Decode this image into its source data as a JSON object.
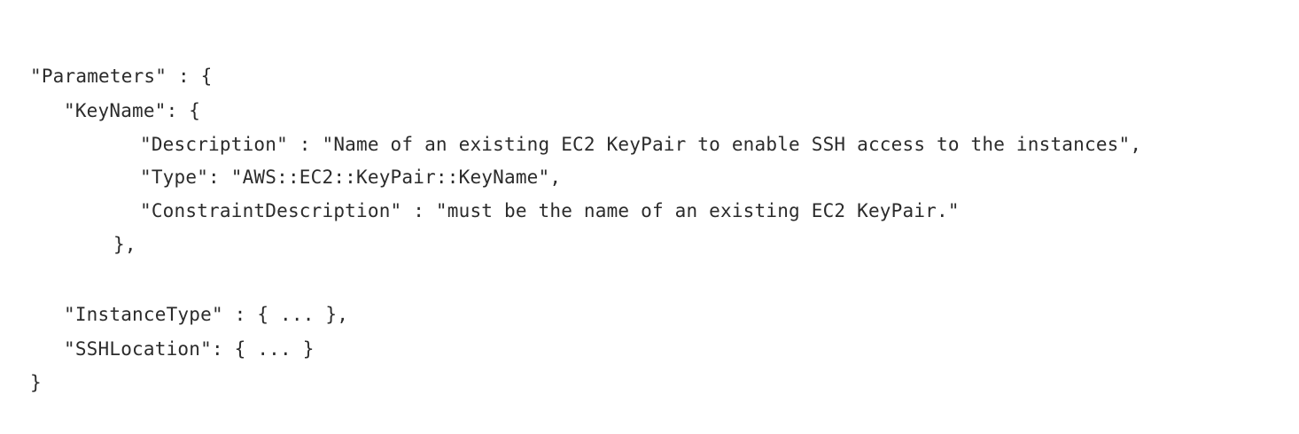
{
  "code": {
    "lines": [
      "\"Parameters\" : {",
      "\"KeyName\": {",
      "\"Description\" : \"Name of an existing EC2 KeyPair to enable SSH access to the instances\",",
      "\"Type\": \"AWS::EC2::KeyPair::KeyName\",",
      "\"ConstraintDescription\" : \"must be the name of an existing EC2 KeyPair.\"",
      "},",
      "\"InstanceType\" : { ... },",
      "\"SSHLocation\": { ... }",
      "}"
    ]
  }
}
